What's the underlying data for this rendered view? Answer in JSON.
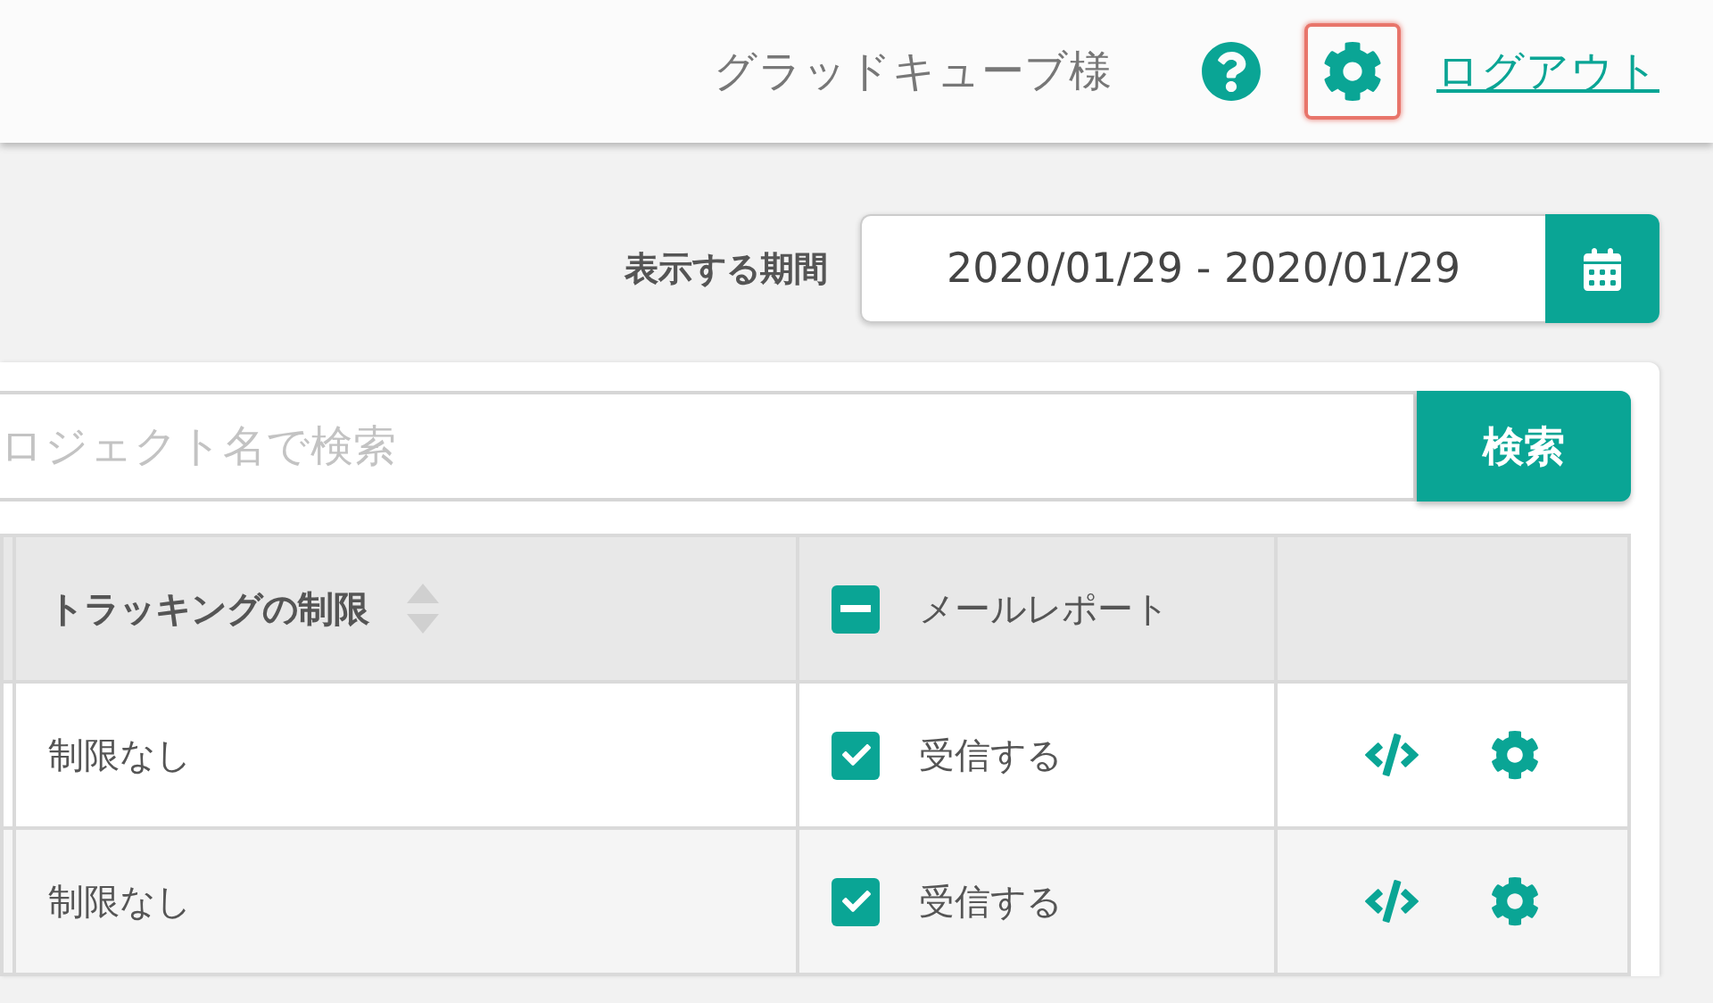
{
  "header": {
    "user_name": "グラッドキューブ様",
    "logout": "ログアウト",
    "settings_selected": true
  },
  "period": {
    "label": "表示する期間",
    "value": "2020/01/29 - 2020/01/29"
  },
  "search": {
    "placeholder": "ロジェクト名で検索",
    "button": "検索"
  },
  "table": {
    "columns": [
      {
        "kind": "blank"
      },
      {
        "kind": "sortable",
        "label": "トラッキングの制限"
      },
      {
        "kind": "check_all",
        "label": "メールレポート",
        "indeterminate": true
      },
      {
        "kind": "actions"
      }
    ],
    "rows": [
      {
        "limit": "制限なし",
        "mail": "受信する",
        "checked": true
      },
      {
        "limit": "制限なし",
        "mail": "受信する",
        "checked": true
      }
    ]
  }
}
